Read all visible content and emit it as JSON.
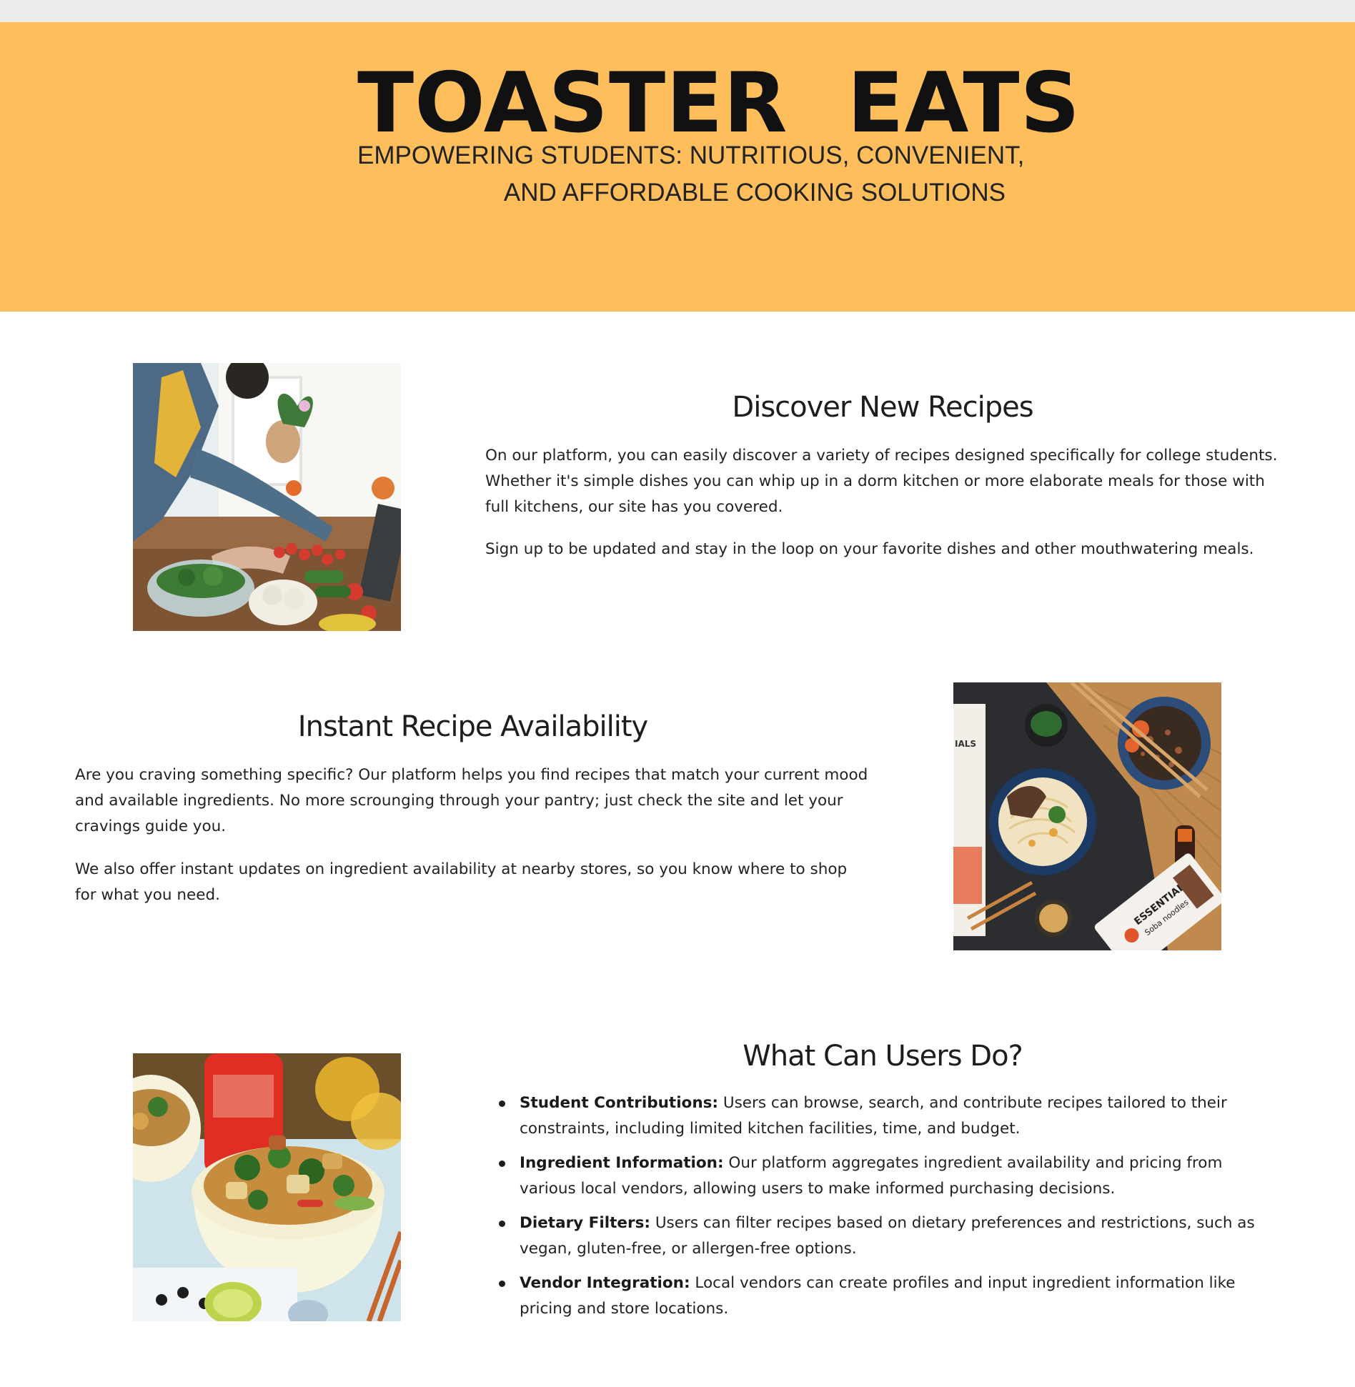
{
  "header": {
    "brand": "TOASTER  EATS",
    "tagline_line1": "EMPOWERING STUDENTS: NUTRITIOUS, CONVENIENT,",
    "tagline_line2": "AND AFFORDABLE COOKING SOLUTIONS"
  },
  "theme": {
    "hero_background": "#febe5c",
    "topbar_background": "#ebebeb",
    "text_color": "#1d1d1d"
  },
  "sections": {
    "discover": {
      "title": "Discover New Recipes",
      "paragraph1": "On our platform, you can easily discover a variety of recipes designed specifically for college students. Whether it's simple dishes you can whip up in a dorm kitchen or more elaborate meals for those with full kitchens, our site has you covered.",
      "paragraph2": "Sign up to be updated and stay in the loop on your favorite dishes and other mouthwatering meals."
    },
    "instant": {
      "title": "Instant Recipe Availability",
      "paragraph1": "Are you craving something specific? Our platform helps you find recipes that match your current mood and available ingredients. No more scrounging through your pantry; just check the site and let your cravings guide you.",
      "paragraph2": "We also offer instant updates on ingredient availability at nearby stores, so you know where to shop for what you need."
    },
    "users": {
      "title": "What Can Users Do?",
      "items": [
        {
          "label": "Student Contributions:",
          "text": " Users can browse, search, and contribute recipes tailored to their constraints, including limited kitchen facilities, time, and budget."
        },
        {
          "label": "Ingredient Information:",
          "text": " Our platform aggregates ingredient availability and pricing from various local vendors, allowing users to make informed purchasing decisions."
        },
        {
          "label": "Dietary Filters:",
          "text": " Users can filter recipes based on dietary preferences and restrictions, such as vegan, gluten-free, or allergen-free options."
        },
        {
          "label": "Vendor Integration:",
          "text": " Local vendors can create profiles and input ingredient information like pricing and store locations."
        }
      ]
    }
  },
  "images": {
    "photo1": "cooking-vegetables-photo",
    "photo2": "noodle-bowls-photo",
    "photo3": "stir-fry-bowl-photo",
    "package_text": "ESSENTIALS",
    "package_subtext": "Soba noodles",
    "package_partial_text": "IALS"
  }
}
